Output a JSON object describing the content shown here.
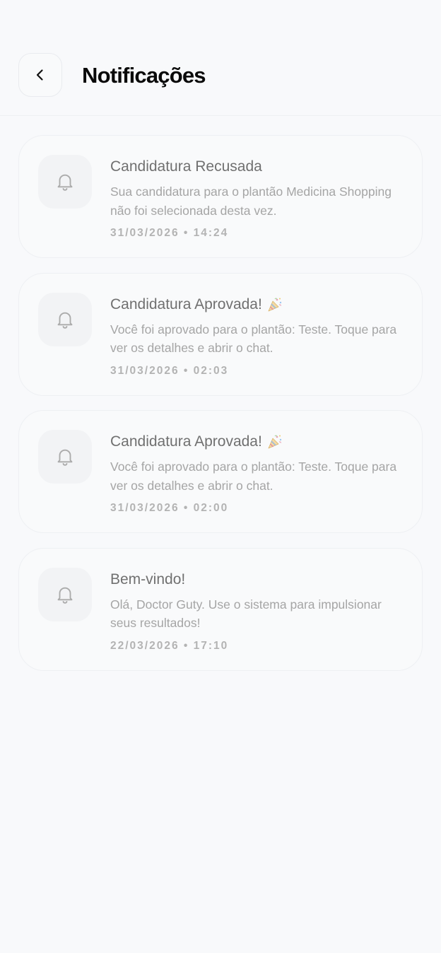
{
  "header": {
    "title": "Notificações",
    "back_icon": "chevron-left-icon"
  },
  "notifications": [
    {
      "title": "Candidatura Recusada",
      "emoji": "",
      "body": "Sua candidatura para o plantão Medicina Shopping não foi selecionada desta vez.",
      "time": "31/03/2026 • 14:24",
      "icon": "bell-icon"
    },
    {
      "title": "Candidatura Aprovada!",
      "emoji": "party-popper",
      "body": "Você foi aprovado para o plantão: Teste. Toque para ver os detalhes e abrir o chat.",
      "time": "31/03/2026 • 02:03",
      "icon": "bell-icon"
    },
    {
      "title": "Candidatura Aprovada!",
      "emoji": "party-popper",
      "body": "Você foi aprovado para o plantão: Teste. Toque para ver os detalhes e abrir o chat.",
      "time": "31/03/2026 • 02:00",
      "icon": "bell-icon"
    },
    {
      "title": "Bem-vindo!",
      "emoji": "",
      "body": "Olá, Doctor Guty. Use o sistema para impulsionar seus resultados!",
      "time": "22/03/2026 • 17:10",
      "icon": "bell-icon"
    }
  ],
  "colors": {
    "background": "#f8f9fb",
    "title": "#0a0a0a",
    "notif_title": "#707070",
    "notif_body": "#a5a5a5",
    "notif_time": "#b3b3b3"
  }
}
